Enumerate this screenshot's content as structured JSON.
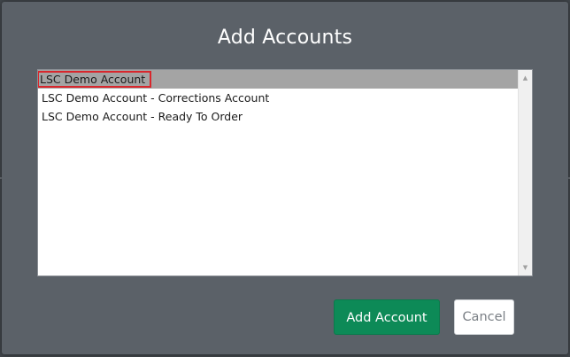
{
  "dialog": {
    "title": "Add Accounts"
  },
  "accounts": {
    "items": [
      {
        "label": "LSC Demo Account",
        "selected": true
      },
      {
        "label": "LSC Demo Account - Corrections Account",
        "selected": false
      },
      {
        "label": "LSC Demo Account - Ready To Order",
        "selected": false
      }
    ]
  },
  "buttons": {
    "add_label": "Add Account",
    "cancel_label": "Cancel"
  },
  "icons": {
    "scroll_up": "scroll-up-arrow-icon",
    "scroll_down": "scroll-down-arrow-icon"
  },
  "colors": {
    "primary": "#0d8a57",
    "selection": "#a4a4a4",
    "highlight_outline": "#d9262c",
    "dialog_bg": "#5b6168"
  }
}
